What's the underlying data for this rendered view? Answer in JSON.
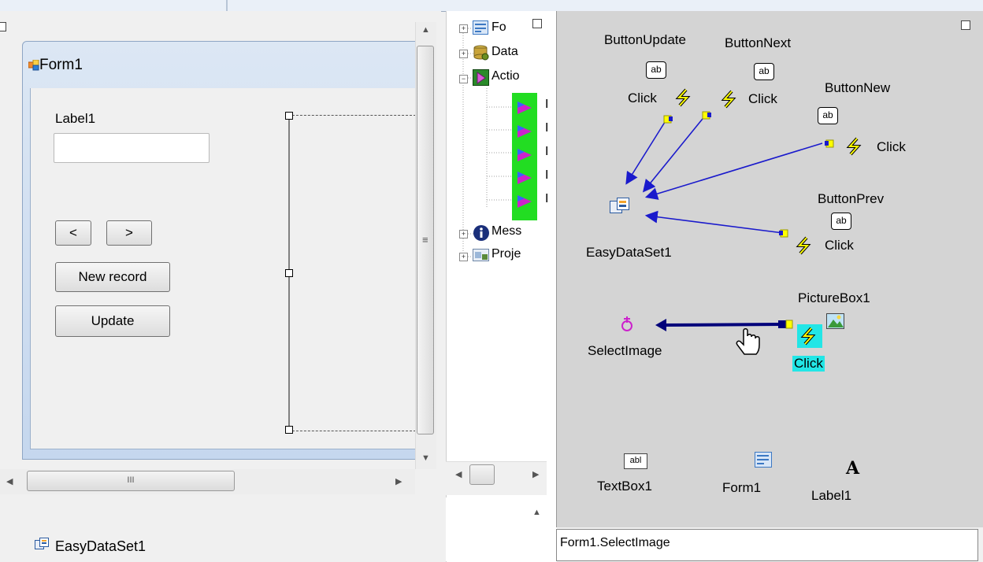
{
  "designer": {
    "form_title": "Form1",
    "label1": "Label1",
    "textbox_value": "",
    "prev_label": "<",
    "next_label": ">",
    "new_label": "New record",
    "update_label": "Update",
    "hscroll_grip": "III",
    "tray_component": "EasyDataSet1"
  },
  "tree": {
    "items": [
      {
        "label": "Fo",
        "expander": "+"
      },
      {
        "label": "Data",
        "expander": "+"
      },
      {
        "label": "Actio",
        "expander": "−"
      },
      {
        "label": "Mess",
        "expander": "+"
      },
      {
        "label": "Proje",
        "expander": "+"
      }
    ],
    "action_children": [
      "I",
      "I",
      "I",
      "I",
      "I"
    ]
  },
  "diagram": {
    "button_update": "ButtonUpdate",
    "button_next": "ButtonNext",
    "button_new": "ButtonNew",
    "button_prev": "ButtonPrev",
    "ab_glyph": "ab",
    "click": "Click",
    "easy_dataset": "EasyDataSet1",
    "picturebox": "PictureBox1",
    "select_image": "SelectImage",
    "textbox": "TextBox1",
    "textbox_glyph": "abl",
    "form": "Form1",
    "label": "Label1",
    "label_glyph": "A"
  },
  "status": {
    "text": "Form1.SelectImage"
  },
  "colors": {
    "arrow_blue": "#1a1acc",
    "arrow_dark": "#00007a",
    "event_yellow": "#ffff00",
    "highlight_cyan": "#22e6e6",
    "action_green": "#22dd22",
    "action_magenta": "#cc22cc"
  }
}
